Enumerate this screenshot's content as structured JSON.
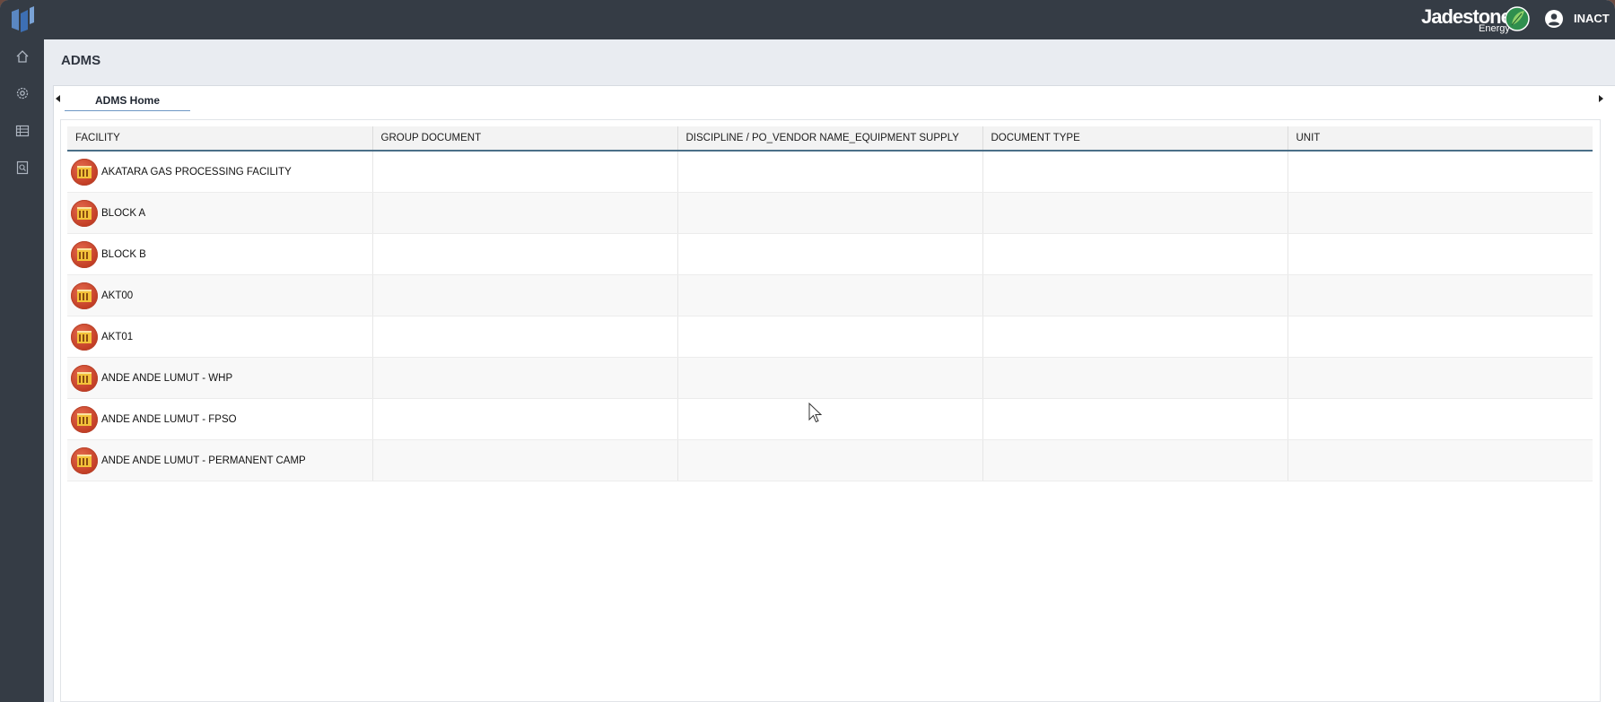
{
  "app": {
    "page_title": "ADMS",
    "brand_name": "Jadestone",
    "brand_sub": "Energy",
    "user_label": "INACT"
  },
  "tabs": [
    {
      "label": "ADMS Home"
    }
  ],
  "grid": {
    "columns": [
      "FACILITY",
      "GROUP DOCUMENT",
      "DISCIPLINE / PO_VENDOR NAME_EQUIPMENT SUPPLY",
      "DOCUMENT TYPE",
      "UNIT"
    ],
    "rows": [
      {
        "facility": "AKATARA GAS PROCESSING FACILITY"
      },
      {
        "facility": "BLOCK A"
      },
      {
        "facility": "BLOCK B"
      },
      {
        "facility": "AKT00"
      },
      {
        "facility": "AKT01"
      },
      {
        "facility": "ANDE ANDE LUMUT - WHP"
      },
      {
        "facility": "ANDE ANDE LUMUT - FPSO"
      },
      {
        "facility": "ANDE ANDE LUMUT - PERMANENT CAMP"
      }
    ]
  },
  "sidebar": {
    "icons": [
      "home-icon",
      "settings-gear-icon",
      "grid-list-icon",
      "document-search-icon"
    ]
  },
  "colors": {
    "topbar": "#353c45",
    "facility_icon": "#c9452c",
    "header_border": "#4a6f88",
    "tab_underline": "#6d97c4"
  }
}
